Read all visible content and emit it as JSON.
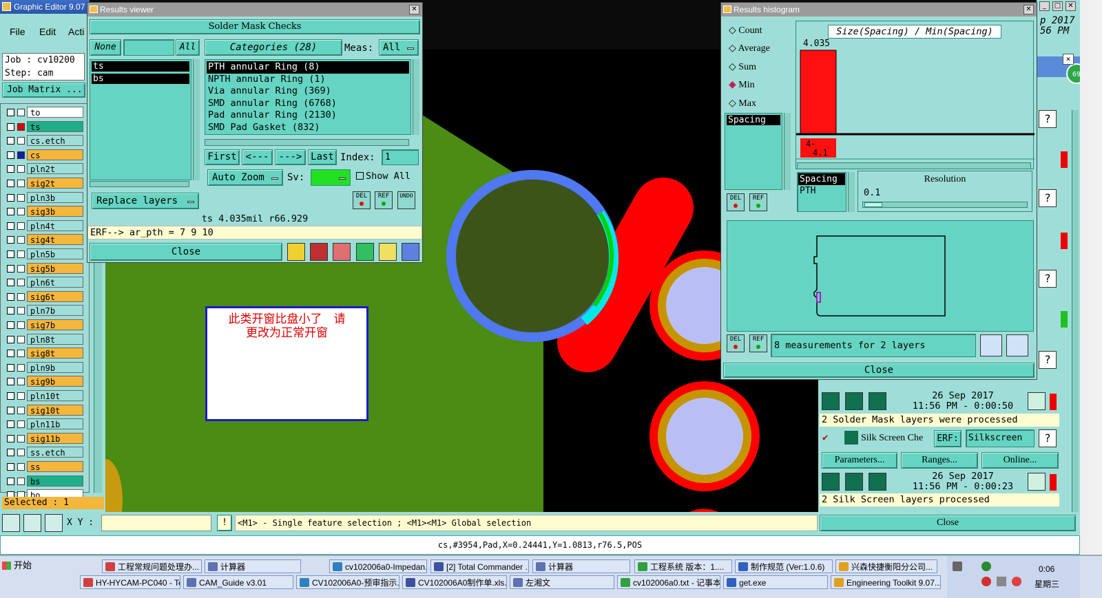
{
  "main_window": {
    "title": "Graphic Editor 9.07"
  },
  "menu": [
    "File",
    "Edit",
    "Acti"
  ],
  "job": {
    "job_label": "Job : cv10200",
    "step_label": "Step: cam",
    "matrix_button": "Job Matrix ..."
  },
  "layers": [
    {
      "name": "to",
      "color": "#ffffff",
      "mark": "#ffffff"
    },
    {
      "name": "ts",
      "color": "#1fae89",
      "mark": "#e00000"
    },
    {
      "name": "cs.etch",
      "color": "#9fded8",
      "mark": "#ffffff"
    },
    {
      "name": "cs",
      "color": "#f5b63c",
      "mark": "#1a1aa0"
    },
    {
      "name": "pln2t",
      "color": "#9fded8",
      "mark": "#ffffff"
    },
    {
      "name": "sig2t",
      "color": "#f5b63c",
      "mark": "#ffffff"
    },
    {
      "name": "pln3b",
      "color": "#9fded8",
      "mark": "#ffffff"
    },
    {
      "name": "sig3b",
      "color": "#f5b63c",
      "mark": "#ffffff"
    },
    {
      "name": "pln4t",
      "color": "#9fded8",
      "mark": "#ffffff"
    },
    {
      "name": "sig4t",
      "color": "#f5b63c",
      "mark": "#ffffff"
    },
    {
      "name": "pln5b",
      "color": "#9fded8",
      "mark": "#ffffff"
    },
    {
      "name": "sig5b",
      "color": "#f5b63c",
      "mark": "#ffffff"
    },
    {
      "name": "pln6t",
      "color": "#9fded8",
      "mark": "#ffffff"
    },
    {
      "name": "sig6t",
      "color": "#f5b63c",
      "mark": "#ffffff"
    },
    {
      "name": "pln7b",
      "color": "#9fded8",
      "mark": "#ffffff"
    },
    {
      "name": "sig7b",
      "color": "#f5b63c",
      "mark": "#ffffff"
    },
    {
      "name": "pln8t",
      "color": "#9fded8",
      "mark": "#ffffff"
    },
    {
      "name": "sig8t",
      "color": "#f5b63c",
      "mark": "#ffffff"
    },
    {
      "name": "pln9b",
      "color": "#9fded8",
      "mark": "#ffffff"
    },
    {
      "name": "sig9b",
      "color": "#f5b63c",
      "mark": "#ffffff"
    },
    {
      "name": "pln10t",
      "color": "#9fded8",
      "mark": "#ffffff"
    },
    {
      "name": "sig10t",
      "color": "#f5b63c",
      "mark": "#ffffff"
    },
    {
      "name": "pln11b",
      "color": "#9fded8",
      "mark": "#ffffff"
    },
    {
      "name": "sig11b",
      "color": "#f5b63c",
      "mark": "#ffffff"
    },
    {
      "name": "ss.etch",
      "color": "#9fded8",
      "mark": "#ffffff"
    },
    {
      "name": "ss",
      "color": "#f5b63c",
      "mark": "#ffffff"
    },
    {
      "name": "bs",
      "color": "#1fae89",
      "mark": "#ffffff"
    },
    {
      "name": "bo",
      "color": "#ffffff",
      "mark": "#ffffff"
    }
  ],
  "selected_label": "Selected : 1",
  "xy": {
    "label": "X Y :",
    "value": "",
    "excl": "!"
  },
  "hint": "<M1> - Single feature selection ; <M1><M1> Global selection",
  "status_line": "cs,#3954,Pad,X=0.24441,Y=1.0813,r76.5,POS",
  "annotation": {
    "line1": "此类开窗比盘小了　请",
    "line2": "更改为正常开窗"
  },
  "results_viewer": {
    "title": "Results viewer",
    "header": "Solder Mask Checks",
    "none_btn": "None",
    "all_btn": "All",
    "layers": [
      "ts",
      "bs"
    ],
    "categories_btn": "Categories (28)",
    "meas_label": "Meas:",
    "meas_value": "All",
    "categories": [
      "PTH annular Ring (8)",
      "NPTH annular Ring (1)",
      "Via annular Ring (369)",
      "SMD annular Ring (6768)",
      "Pad annular Ring (2130)",
      "SMD Pad Gasket (832)"
    ],
    "nav": {
      "first": "First",
      "prev": "<---",
      "next": "--->",
      "last": "Last",
      "index_label": "Index:",
      "index_value": "1"
    },
    "auto_zoom": "Auto Zoom",
    "sv_label": "Sv:",
    "show_all": "Show All",
    "replace_layers": "Replace layers",
    "del": "DEL",
    "ref": "REF",
    "undo": "UNDO",
    "measure_line": "ts 4.035mil  r66.929",
    "erf_line": "ERF--> ar_pth = 7 9 10",
    "close": "Close"
  },
  "histogram": {
    "title": "Results histogram",
    "modes": [
      "Count",
      "Average",
      "Sum",
      "Min",
      "Max"
    ],
    "active_mode": "Min",
    "list": [
      "Spacing"
    ],
    "chart_title": "Size(Spacing) / Min(Spacing)",
    "chart_value_label": "4.035",
    "bin_label": "4-\n4.1",
    "sel_lines": [
      "Spacing",
      "PTH"
    ],
    "resolution_label": "Resolution",
    "resolution_value": "0.1",
    "measurements": "8 measurements for 2 layers",
    "close": "Close",
    "del": "DEL",
    "ref": "REF"
  },
  "chart_data": {
    "type": "bar",
    "title": "Size(Spacing) / Min(Spacing)",
    "categories": [
      "4-4.1"
    ],
    "values": [
      4.035
    ],
    "ylim": [
      0,
      4.035
    ]
  },
  "right_panel": {
    "top_value": "p 2017",
    "top_value2": "56 PM",
    "tab_btns": [
      "Parameters...",
      "Ranges...",
      "Online..."
    ],
    "sm_date": "26 Sep 2017",
    "sm_time": "11:56 PM - 0:00:50",
    "sm_result": "2 Solder Mask layers were processed",
    "silk_label": "Silk Screen Che",
    "erf_label": "ERF:",
    "erf_value": "Silkscreen",
    "ss_date": "26 Sep 2017",
    "ss_time": "11:56 PM - 0:00:23",
    "ss_result": "2 Silk Screen layers processed",
    "close": "Close",
    "question": "?",
    "badge": "69"
  },
  "taskbar": {
    "start": "开始",
    "row1": [
      "工程常规问题处理办...",
      "计算器",
      "cv102006a0-Impedan...",
      "[2] Total Commander ...",
      "计算器",
      "工程系统  版本：1....",
      "制作规范 (Ver:1.0.6)",
      "兴森快捷衡阳分公司..."
    ],
    "row2": [
      "HY-HYCAM-PC040 - Tea...",
      "CAM_Guide v3.01",
      "CV102006A0-预审指示....",
      "CV102006A0制作单.xls...",
      "左湘文",
      "cv102006a0.txt - 记事本",
      "get.exe",
      "Engineering Toolkit 9.07..."
    ],
    "time": "0:06",
    "day": "星期三"
  }
}
